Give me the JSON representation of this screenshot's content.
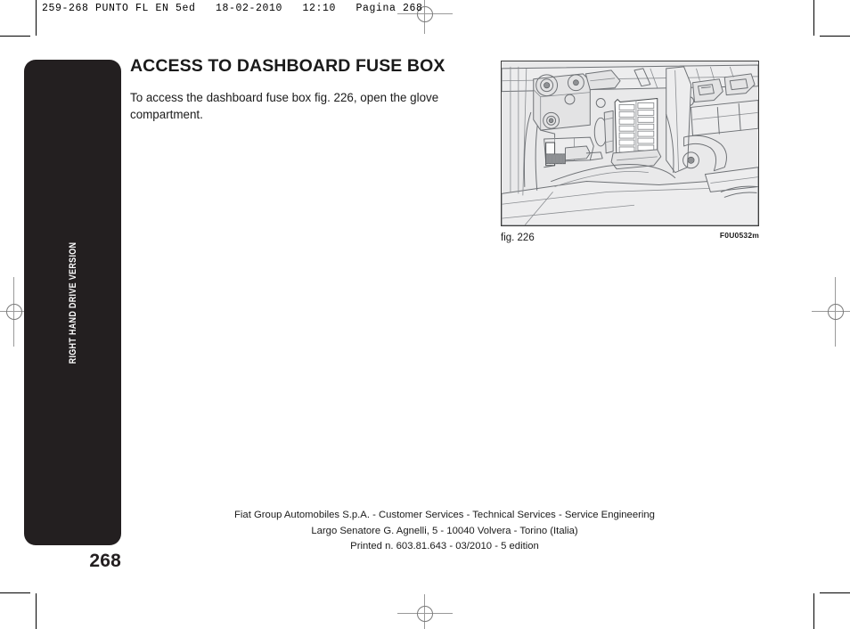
{
  "print_header": {
    "text": "259-268 PUNTO FL EN 5ed   18-02-2010   12:10   Pagina 268"
  },
  "side_tab": {
    "label": "RIGHT HAND DRIVE VERSION",
    "background_color": "#231f20",
    "text_color": "#ffffff"
  },
  "page_number": "268",
  "article": {
    "title": "ACCESS TO DASHBOARD FUSE BOX",
    "body": "To access the dashboard fuse box fig. 226, open the glove compartment."
  },
  "figure": {
    "caption": "fig. 226",
    "code": "F0U0532m",
    "description": "Line drawing of dashboard interior behind glove compartment showing the fuse box",
    "frame_color": "#3d3d3d",
    "background_color": "#e9e9ea"
  },
  "footer": {
    "lines": [
      "Fiat Group Automobiles S.p.A. - Customer Services - Technical Services - Service Engineering",
      "Largo Senatore G. Agnelli, 5 - 10040 Volvera - Torino (Italia)",
      "Printed n. 603.81.643 - 03/2010 - 5 edition"
    ]
  }
}
